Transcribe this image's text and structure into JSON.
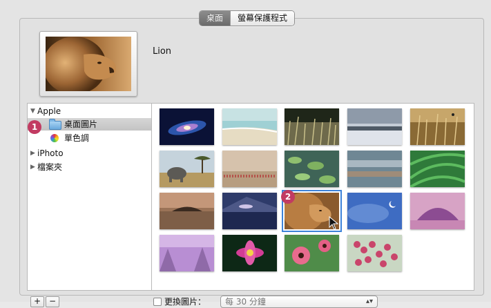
{
  "tabs": [
    {
      "label": "桌面",
      "active": true
    },
    {
      "label": "螢幕保護程式",
      "active": false
    }
  ],
  "preview": {
    "name": "Lion"
  },
  "sidebar": {
    "items": [
      {
        "label": "Apple",
        "disclosure": "expanded",
        "level": 0
      },
      {
        "label": "桌面圖片",
        "icon": "folder-icon",
        "level": 1,
        "selected": true
      },
      {
        "label": "單色調",
        "icon": "color-wheel-icon",
        "level": 1
      },
      {
        "label": "iPhoto",
        "disclosure": "collapsed",
        "level": 0
      },
      {
        "label": "檔案夾",
        "disclosure": "collapsed",
        "level": 0
      }
    ]
  },
  "thumbnails": [
    {
      "name": "galaxy"
    },
    {
      "name": "beach-sea"
    },
    {
      "name": "grass-field"
    },
    {
      "name": "lake-clouds"
    },
    {
      "name": "golden-grass"
    },
    {
      "name": "elephant"
    },
    {
      "name": "flamingos"
    },
    {
      "name": "lily-pads"
    },
    {
      "name": "misty-water"
    },
    {
      "name": "green-leaves"
    },
    {
      "name": "island-sunset"
    },
    {
      "name": "mountain-lake"
    },
    {
      "name": "lion",
      "selected": true
    },
    {
      "name": "moon-sky"
    },
    {
      "name": "pink-mountain"
    },
    {
      "name": "purple-mist"
    },
    {
      "name": "lotus-flower"
    },
    {
      "name": "pink-poppies"
    },
    {
      "name": "pink-berries"
    }
  ],
  "badges": {
    "first": "1",
    "second": "2"
  },
  "bottom": {
    "add_label": "+",
    "remove_label": "−",
    "change_picture_label": "更換圖片：",
    "interval_value": "每 30 分鐘"
  },
  "colors": {
    "badge": "#c23b62",
    "selection": "#3d82d9"
  }
}
